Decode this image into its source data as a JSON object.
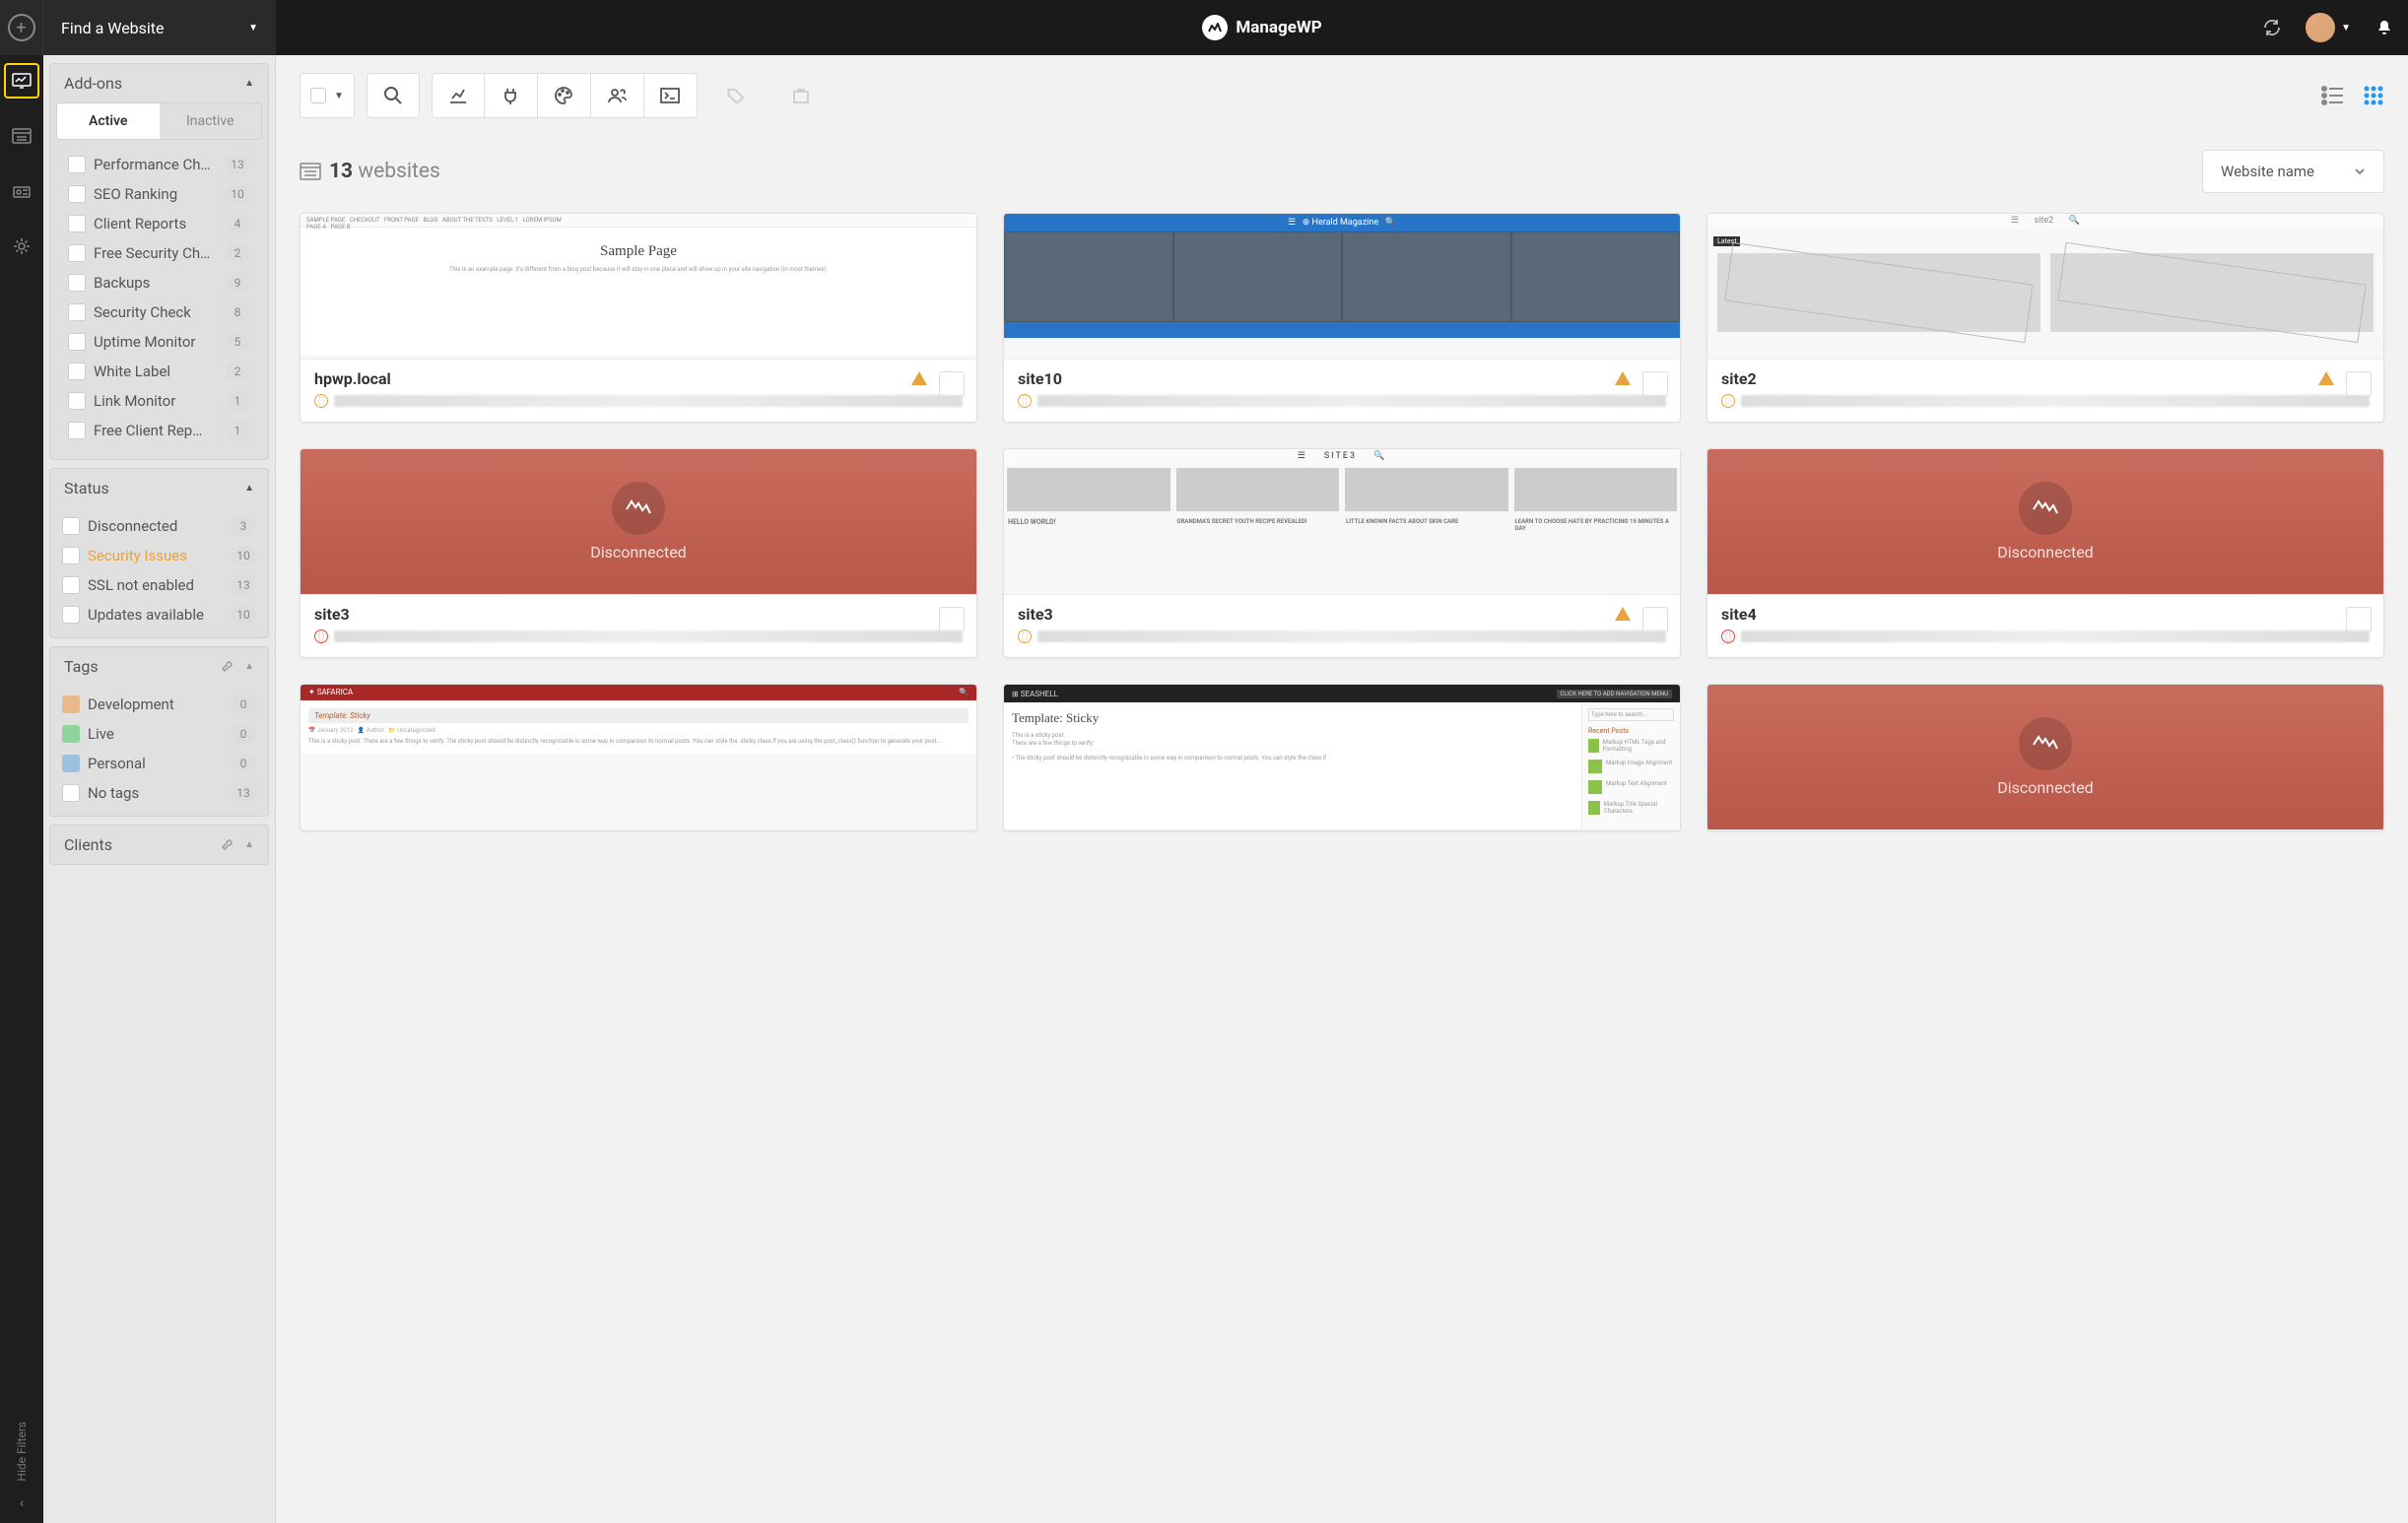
{
  "topbar": {
    "find": "Find a Website",
    "brand": "ManageWP"
  },
  "filters": {
    "hide_label": "Hide Filters",
    "addons": {
      "title": "Add-ons",
      "tabs": {
        "active": "Active",
        "inactive": "Inactive"
      },
      "items": [
        {
          "label": "Performance Ch…",
          "count": "13"
        },
        {
          "label": "SEO Ranking",
          "count": "10"
        },
        {
          "label": "Client Reports",
          "count": "4"
        },
        {
          "label": "Free Security Ch…",
          "count": "2"
        },
        {
          "label": "Backups",
          "count": "9"
        },
        {
          "label": "Security Check",
          "count": "8"
        },
        {
          "label": "Uptime Monitor",
          "count": "5"
        },
        {
          "label": "White Label",
          "count": "2"
        },
        {
          "label": "Link Monitor",
          "count": "1"
        },
        {
          "label": "Free Client Rep…",
          "count": "1"
        }
      ]
    },
    "status": {
      "title": "Status",
      "items": [
        {
          "label": "Disconnected",
          "count": "3"
        },
        {
          "label": "Security Issues",
          "count": "10",
          "hl": true
        },
        {
          "label": "SSL not enabled",
          "count": "13"
        },
        {
          "label": "Updates available",
          "count": "10"
        }
      ]
    },
    "tags": {
      "title": "Tags",
      "items": [
        {
          "label": "Development",
          "count": "0",
          "color": "#e8b98a"
        },
        {
          "label": "Live",
          "count": "0",
          "color": "#8fd49a"
        },
        {
          "label": "Personal",
          "count": "0",
          "color": "#9cc0df"
        },
        {
          "label": "No tags",
          "count": "13",
          "color": "#ffffff"
        }
      ]
    },
    "clients": {
      "title": "Clients"
    }
  },
  "main": {
    "count": "13",
    "count_label": "websites",
    "sort": "Website name",
    "disconnected": "Disconnected",
    "sites": [
      {
        "name": "hpwp.local",
        "warn": true,
        "globe": "orange",
        "type": "sample",
        "t": "Sample Page"
      },
      {
        "name": "site10",
        "warn": true,
        "globe": "orange",
        "type": "herald",
        "t": "Herald Magazine"
      },
      {
        "name": "site2",
        "warn": true,
        "globe": "orange",
        "type": "gray",
        "t": "site2"
      },
      {
        "name": "site3",
        "globe": "red",
        "type": "disc"
      },
      {
        "name": "site3",
        "warn": true,
        "globe": "orange",
        "type": "site3",
        "t": "SITE3"
      },
      {
        "name": "site4",
        "globe": "red",
        "type": "disc"
      },
      {
        "name": "",
        "type": "safarica",
        "t": "SAFARICA",
        "sub": "Template: Sticky"
      },
      {
        "name": "",
        "type": "seashell",
        "t": "SEASHELL",
        "sub": "Template: Sticky"
      },
      {
        "name": "",
        "type": "disc"
      }
    ]
  }
}
